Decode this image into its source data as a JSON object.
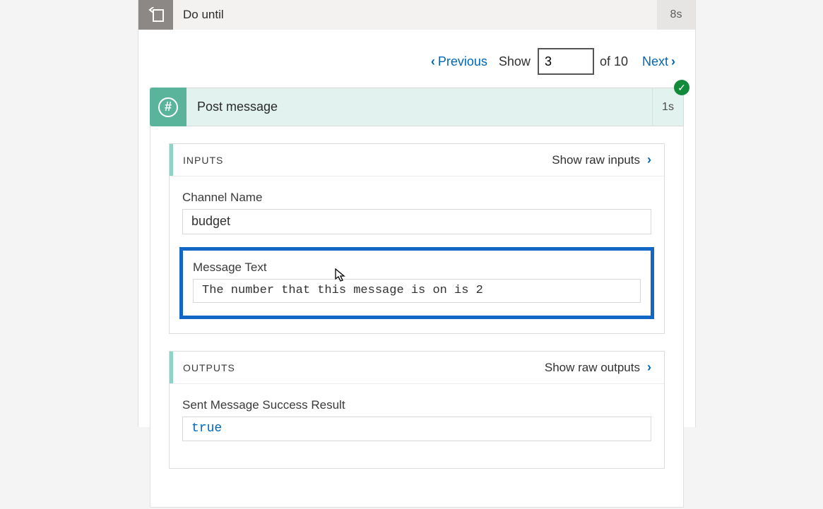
{
  "doUntil": {
    "title": "Do until",
    "duration": "8s"
  },
  "pager": {
    "previous": "Previous",
    "show": "Show",
    "value": "3",
    "of": "of 10",
    "next": "Next"
  },
  "action": {
    "title": "Post message",
    "duration": "1s",
    "status_icon": "check"
  },
  "inputs": {
    "sectionTitle": "INPUTS",
    "showRaw": "Show raw inputs",
    "channelName": {
      "label": "Channel Name",
      "value": "budget"
    },
    "messageText": {
      "label": "Message Text",
      "value": "The number that this message is on is 2"
    }
  },
  "outputs": {
    "sectionTitle": "OUTPUTS",
    "showRaw": "Show raw outputs",
    "successResult": {
      "label": "Sent Message Success Result",
      "value": "true"
    }
  }
}
